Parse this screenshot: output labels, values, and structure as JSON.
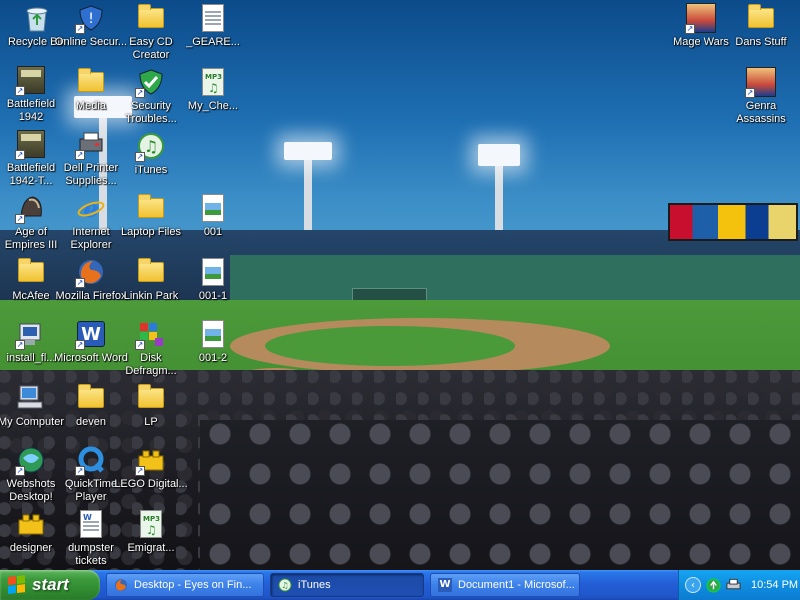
{
  "desktop": {
    "icons": [
      {
        "label": "Recycle Bin",
        "icon": "recycle-bin-icon"
      },
      {
        "label": "Online Secur...",
        "icon": "security-shield-icon"
      },
      {
        "label": "Easy CD Creator",
        "icon": "folder-icon"
      },
      {
        "label": "_GEARE...",
        "icon": "text-document-icon"
      },
      {
        "label": "Battlefield 1942",
        "icon": "game-icon"
      },
      {
        "label": "Media",
        "icon": "folder-icon"
      },
      {
        "label": "Security Troubles...",
        "icon": "security-check-icon"
      },
      {
        "label": "My_Che...",
        "icon": "mp3-file-icon"
      },
      {
        "label": "Battlefield 1942-T...",
        "icon": "game-icon"
      },
      {
        "label": "Dell Printer Supplies...",
        "icon": "printer-icon"
      },
      {
        "label": "iTunes",
        "icon": "itunes-icon"
      },
      {
        "label": "Age of Empires III",
        "icon": "game-helmet-icon"
      },
      {
        "label": "Internet Explorer",
        "icon": "internet-explorer-icon"
      },
      {
        "label": "Laptop Files",
        "icon": "folder-icon"
      },
      {
        "label": "001",
        "icon": "image-file-icon"
      },
      {
        "label": "McAfee",
        "icon": "folder-icon"
      },
      {
        "label": "Mozilla Firefox",
        "icon": "firefox-icon"
      },
      {
        "label": "Linkin Park",
        "icon": "folder-icon"
      },
      {
        "label": "001-1",
        "icon": "image-file-icon"
      },
      {
        "label": "install_fl...",
        "icon": "installer-icon"
      },
      {
        "label": "Microsoft Word",
        "icon": "word-icon"
      },
      {
        "label": "Disk Defragm...",
        "icon": "defrag-icon"
      },
      {
        "label": "001-2",
        "icon": "image-file-icon"
      },
      {
        "label": "My Computer",
        "icon": "my-computer-icon"
      },
      {
        "label": "deven",
        "icon": "folder-icon"
      },
      {
        "label": "LP",
        "icon": "folder-icon"
      },
      {
        "label": "Webshots Desktop!",
        "icon": "webshots-icon"
      },
      {
        "label": "QuickTime Player",
        "icon": "quicktime-icon"
      },
      {
        "label": "LEGO Digital...",
        "icon": "lego-icon"
      },
      {
        "label": "designer",
        "icon": "lego-brick-icon"
      },
      {
        "label": "dumpster tickets",
        "icon": "word-document-icon"
      },
      {
        "label": "Emigrat...",
        "icon": "mp3-file-icon"
      },
      {
        "label": "Mage Wars",
        "icon": "game-avatar-icon"
      },
      {
        "label": "Dans Stuff",
        "icon": "folder-icon"
      },
      {
        "label": "Genra Assassins",
        "icon": "game-avatar-icon"
      }
    ]
  },
  "taskbar": {
    "start_label": "start",
    "buttons": [
      {
        "label": "Desktop - Eyes on Fin...",
        "icon": "firefox-icon"
      },
      {
        "label": "iTunes",
        "icon": "itunes-icon"
      },
      {
        "label": "Document1 - Microsof...",
        "icon": "word-icon"
      }
    ],
    "clock": "10:54 PM",
    "tray_icons": [
      "expand-tray-icon",
      "network-icon",
      "printer-icon"
    ]
  },
  "colors": {
    "taskbar_blue": "#235fd7",
    "start_green": "#3c9a3c",
    "tray_blue": "#0f8ee0"
  }
}
